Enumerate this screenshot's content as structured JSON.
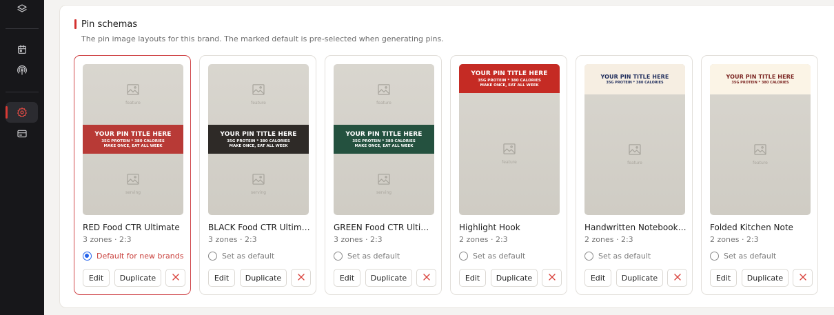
{
  "sidebar": {
    "icons": [
      "layers-icon",
      "calendar-icon",
      "podcast-icon",
      "settings-icon",
      "card-icon"
    ],
    "accent": "#d93a35"
  },
  "section": {
    "title": "Pin schemas",
    "subtitle": "The pin image layouts for this brand. The marked default is pre-selected when generating pins."
  },
  "placeholder": {
    "title": "YOUR PIN TITLE HERE",
    "line2": "35G PROTEIN * 380 CALORIES",
    "line3": "MAKE ONCE, EAT ALL WEEK"
  },
  "labels": {
    "feature": "feature",
    "serving": "serving",
    "edit": "Edit",
    "duplicate": "Duplicate",
    "set_default": "Set as default",
    "default_for_new": "Default for new brands"
  },
  "schemas": [
    {
      "name": "RED Food CTR Ultimate",
      "meta": "3 zones · 2:3",
      "band_color": "#b83a36",
      "is_default": true
    },
    {
      "name": "BLACK Food CTR Ultimate",
      "meta": "3 zones · 2:3",
      "band_color": "#2e2a27",
      "is_default": false
    },
    {
      "name": "GREEN Food CTR Ultimate",
      "meta": "3 zones · 2:3",
      "band_color": "#24513f",
      "is_default": false
    },
    {
      "name": "Highlight Hook",
      "meta": "2 zones · 2:3",
      "band_color": "#c52b24",
      "is_default": false
    },
    {
      "name": "Handwritten Notebook Card",
      "meta": "2 zones · 2:3",
      "band_color": "#f6eee2",
      "is_default": false
    },
    {
      "name": "Folded Kitchen Note",
      "meta": "2 zones · 2:3",
      "band_color": "#fbf4e6",
      "is_default": false
    }
  ]
}
